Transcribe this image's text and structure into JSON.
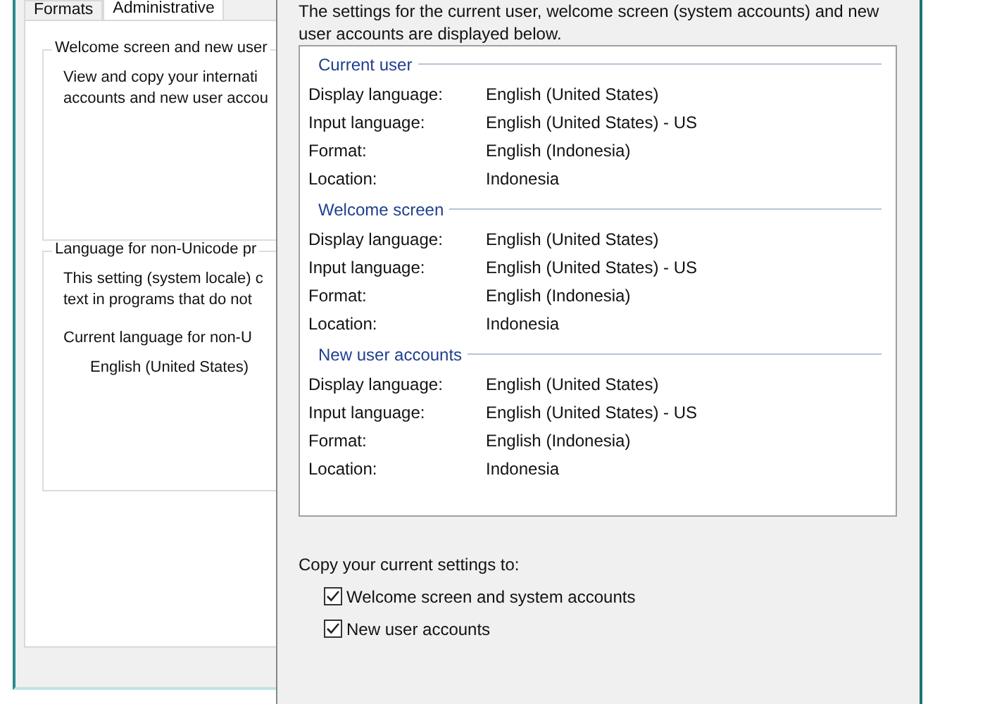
{
  "back_dialog": {
    "tabs": [
      {
        "label": "Formats",
        "selected": false
      },
      {
        "label": "Administrative",
        "selected": true
      }
    ],
    "groups": [
      {
        "title": "Welcome screen and new user",
        "lines": [
          "View and copy your internati",
          "accounts and new user accou"
        ]
      },
      {
        "title": "Language for non-Unicode pr",
        "lines": [
          "This setting (system locale) c",
          "text in programs that do not"
        ],
        "current_label": "Current language for non-U",
        "current_value": "English (United States)"
      }
    ]
  },
  "dialog": {
    "intro_lines": [
      "The settings for the current user, welcome screen (system accounts) and new",
      "user accounts are displayed below."
    ],
    "sections": [
      {
        "title": "Current user",
        "rows": [
          {
            "label": "Display language:",
            "value": "English (United States)"
          },
          {
            "label": "Input language:",
            "value": "English (United States) - US"
          },
          {
            "label": "Format:",
            "value": "English (Indonesia)"
          },
          {
            "label": "Location:",
            "value": "Indonesia"
          }
        ]
      },
      {
        "title": "Welcome screen",
        "rows": [
          {
            "label": "Display language:",
            "value": "English (United States)"
          },
          {
            "label": "Input language:",
            "value": "English (United States) - US"
          },
          {
            "label": "Format:",
            "value": "English (Indonesia)"
          },
          {
            "label": "Location:",
            "value": "Indonesia"
          }
        ]
      },
      {
        "title": "New user accounts",
        "rows": [
          {
            "label": "Display language:",
            "value": "English (United States)"
          },
          {
            "label": "Input language:",
            "value": "English (United States) - US"
          },
          {
            "label": "Format:",
            "value": "English (Indonesia)"
          },
          {
            "label": "Location:",
            "value": "Indonesia"
          }
        ]
      }
    ],
    "copy_label": "Copy your current settings to:",
    "options": [
      {
        "label": "Welcome screen and system accounts",
        "checked": true
      },
      {
        "label": "New user accounts",
        "checked": true
      }
    ]
  }
}
